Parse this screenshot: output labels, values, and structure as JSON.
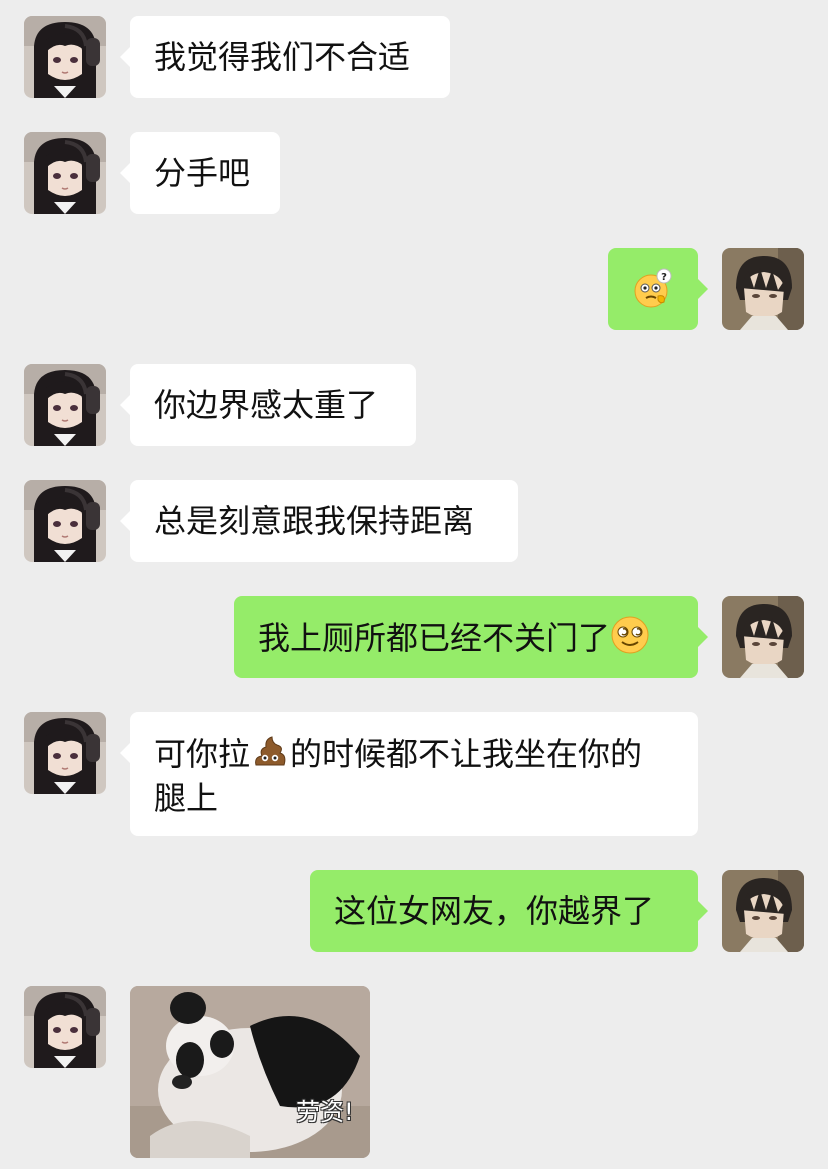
{
  "messages": [
    {
      "side": "recv",
      "text": "我觉得我们不合适"
    },
    {
      "side": "recv",
      "text": "分手吧"
    },
    {
      "side": "sent",
      "emoji": "confused-face-question-emoji"
    },
    {
      "side": "recv",
      "text": "你边界感太重了"
    },
    {
      "side": "recv",
      "text": "总是刻意跟我保持距离"
    },
    {
      "side": "sent",
      "text": "我上厕所都已经不关门了",
      "emoji": "dizzy-smiling-face-emoji"
    },
    {
      "side": "recv",
      "text_before": "可你拉",
      "emoji": "poop-emoji",
      "text_after": "的时候都不让我坐在你的\n腿上"
    },
    {
      "side": "sent",
      "text": "这位女网友，你越界了"
    },
    {
      "side": "recv",
      "sticker": "panda-sticker",
      "sticker_caption": "劳资!"
    }
  ],
  "avatars": {
    "recv": "girl-headphones-avatar",
    "sent": "boy-dark-hair-avatar"
  },
  "colors": {
    "background": "#ededed",
    "recv_bubble": "#ffffff",
    "sent_bubble": "#95ec69",
    "text": "#111111"
  }
}
